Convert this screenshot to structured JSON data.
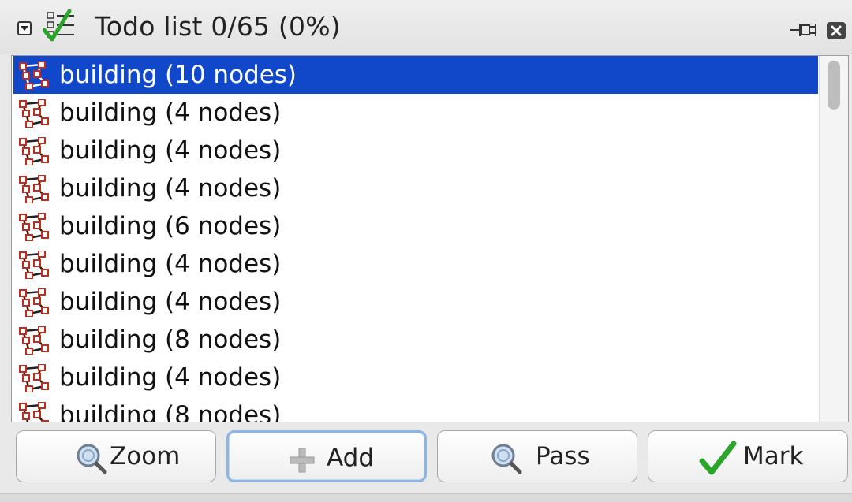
{
  "title": "Todo list 0/65 (0%)",
  "icons": {
    "collapse": "collapse-arrow-icon",
    "todo": "todo-checklist-icon",
    "pin": "pin-icon",
    "close": "close-icon",
    "building": "way-polygon-icon",
    "zoom": "zoom-magnifier-icon",
    "add": "plus-icon",
    "pass": "zoom-magnifier-icon",
    "mark": "checkmark-icon"
  },
  "colors": {
    "selection": "#1048c9",
    "checkmark": "#2aa52a",
    "node_red": "#c62a1a"
  },
  "list": {
    "items": [
      {
        "label": "building (10 nodes)"
      },
      {
        "label": "building (4 nodes)"
      },
      {
        "label": "building (4 nodes)"
      },
      {
        "label": "building (4 nodes)"
      },
      {
        "label": "building (6 nodes)"
      },
      {
        "label": "building (4 nodes)"
      },
      {
        "label": "building (4 nodes)"
      },
      {
        "label": "building (8 nodes)"
      },
      {
        "label": "building (4 nodes)"
      },
      {
        "label": "building (8 nodes)"
      }
    ],
    "selected_index": 0
  },
  "buttons": {
    "zoom": "Zoom",
    "add": "Add",
    "pass": "Pass",
    "mark": "Mark"
  }
}
